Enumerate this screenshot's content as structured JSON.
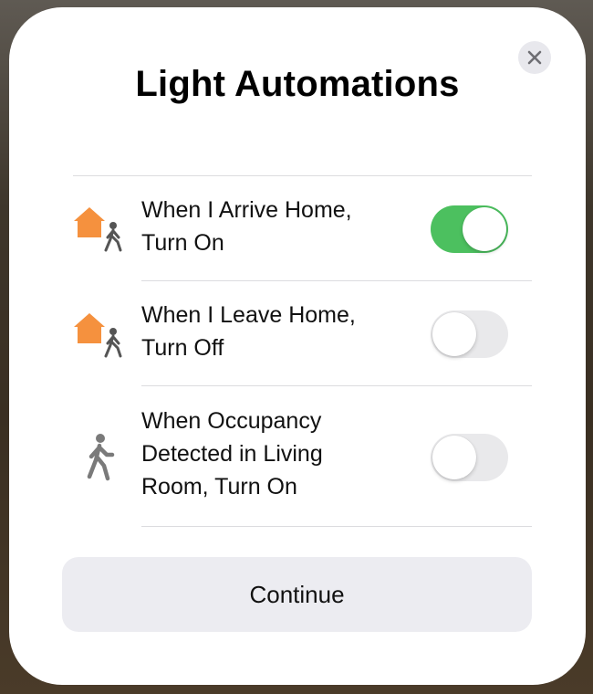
{
  "dialog": {
    "title": "Light Automations",
    "close_icon": "close-icon",
    "continue_label": "Continue"
  },
  "automations": [
    {
      "label_line1": "When I Arrive Home,",
      "label_line2": "Turn On",
      "label_line3": "",
      "icon": "home-arrive-icon",
      "enabled": true
    },
    {
      "label_line1": "When I Leave Home,",
      "label_line2": "Turn Off",
      "label_line3": "",
      "icon": "home-leave-icon",
      "enabled": false
    },
    {
      "label_line1": "When Occupancy",
      "label_line2": "Detected in Living",
      "label_line3": "Room, Turn On",
      "icon": "occupancy-icon",
      "enabled": false
    }
  ],
  "colors": {
    "toggle_on": "#4cc05f",
    "toggle_off": "#e9e9eb",
    "home_icon": "#f5913e",
    "person_icon": "#7a7a7a"
  }
}
